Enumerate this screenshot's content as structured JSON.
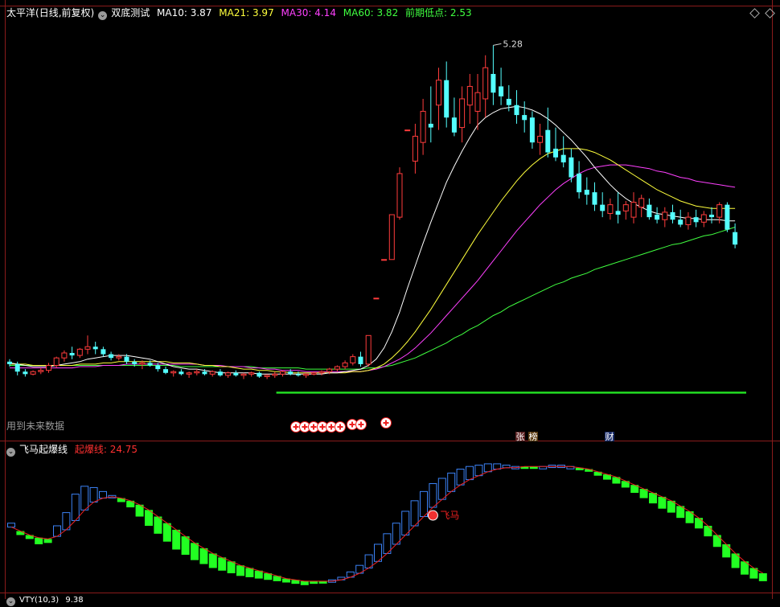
{
  "header_main": {
    "stock": "太平洋",
    "period": "(日线,前复权)",
    "indicator": "双底测试",
    "ma10": "MA10: 3.87",
    "ma21": "MA21: 3.97",
    "ma30": "MA30: 4.14",
    "ma60": "MA60: 3.82",
    "prev_low": "前期低点: 2.53"
  },
  "header_sub": {
    "indicator": "飞马起爆线",
    "line": "起爆线: 24.75"
  },
  "footer_sub": {
    "indicator": "VTY(10,3)",
    "value": "9.38"
  },
  "labels": {
    "future_data": "用到未来数据",
    "tag_zhang": "张",
    "tag_bang": "榜",
    "tag_cai": "财",
    "feima": "飞马",
    "high_price": "5.28"
  },
  "colors": {
    "up": "#ff3c3c",
    "down": "#54ffff",
    "ma10": "#ffffff",
    "ma21": "#ffff3c",
    "ma30": "#ff40ff",
    "ma60": "#40ff40",
    "prev_low": "#22dd22",
    "kline_rise": "#3b82f6",
    "kline_fall": "#22ff22",
    "signal": "#ee2020"
  },
  "chart_data": [
    {
      "type": "candlestick",
      "title": "太平洋 (日线,前复权)",
      "ylim": [
        2.3,
        5.45
      ],
      "high_mark": 5.28,
      "prev_low": 2.53,
      "series_names": [
        "MA10",
        "MA21",
        "MA30",
        "MA60"
      ],
      "candles": [
        [
          2.74,
          2.76,
          2.7,
          2.72
        ],
        [
          2.72,
          2.74,
          2.63,
          2.66
        ],
        [
          2.66,
          2.68,
          2.62,
          2.64
        ],
        [
          2.64,
          2.67,
          2.63,
          2.66
        ],
        [
          2.66,
          2.69,
          2.64,
          2.67
        ],
        [
          2.67,
          2.73,
          2.65,
          2.71
        ],
        [
          2.71,
          2.78,
          2.69,
          2.77
        ],
        [
          2.77,
          2.83,
          2.74,
          2.81
        ],
        [
          2.81,
          2.86,
          2.76,
          2.79
        ],
        [
          2.79,
          2.85,
          2.77,
          2.84
        ],
        [
          2.84,
          2.95,
          2.8,
          2.86
        ],
        [
          2.86,
          2.9,
          2.8,
          2.84
        ],
        [
          2.84,
          2.86,
          2.78,
          2.8
        ],
        [
          2.8,
          2.82,
          2.75,
          2.77
        ],
        [
          2.77,
          2.8,
          2.75,
          2.78
        ],
        [
          2.78,
          2.8,
          2.72,
          2.74
        ],
        [
          2.74,
          2.76,
          2.7,
          2.72
        ],
        [
          2.72,
          2.75,
          2.68,
          2.73
        ],
        [
          2.73,
          2.75,
          2.7,
          2.71
        ],
        [
          2.71,
          2.73,
          2.66,
          2.68
        ],
        [
          2.68,
          2.7,
          2.64,
          2.65
        ],
        [
          2.65,
          2.67,
          2.62,
          2.66
        ],
        [
          2.66,
          2.68,
          2.63,
          2.64
        ],
        [
          2.64,
          2.66,
          2.61,
          2.65
        ],
        [
          2.65,
          2.68,
          2.63,
          2.66
        ],
        [
          2.66,
          2.68,
          2.63,
          2.64
        ],
        [
          2.64,
          2.67,
          2.62,
          2.66
        ],
        [
          2.66,
          2.68,
          2.62,
          2.63
        ],
        [
          2.63,
          2.66,
          2.61,
          2.65
        ],
        [
          2.65,
          2.67,
          2.62,
          2.63
        ],
        [
          2.63,
          2.65,
          2.6,
          2.64
        ],
        [
          2.64,
          2.66,
          2.62,
          2.65
        ],
        [
          2.65,
          2.66,
          2.61,
          2.62
        ],
        [
          2.62,
          2.64,
          2.6,
          2.63
        ],
        [
          2.63,
          2.66,
          2.61,
          2.64
        ],
        [
          2.64,
          2.67,
          2.62,
          2.66
        ],
        [
          2.66,
          2.68,
          2.63,
          2.64
        ],
        [
          2.64,
          2.66,
          2.62,
          2.63
        ],
        [
          2.63,
          2.65,
          2.61,
          2.64
        ],
        [
          2.64,
          2.66,
          2.63,
          2.65
        ],
        [
          2.65,
          2.67,
          2.63,
          2.66
        ],
        [
          2.66,
          2.69,
          2.64,
          2.68
        ],
        [
          2.68,
          2.71,
          2.66,
          2.7
        ],
        [
          2.7,
          2.75,
          2.68,
          2.73
        ],
        [
          2.73,
          2.8,
          2.71,
          2.78
        ],
        [
          2.78,
          2.82,
          2.7,
          2.72
        ],
        [
          2.72,
          2.95,
          2.7,
          2.95
        ],
        [
          3.25,
          3.25,
          3.25,
          3.25
        ],
        [
          3.56,
          3.56,
          3.56,
          3.56
        ],
        [
          3.56,
          3.92,
          3.56,
          3.92
        ],
        [
          3.9,
          4.3,
          3.88,
          4.25
        ],
        [
          4.6,
          4.6,
          4.6,
          4.6
        ],
        [
          4.35,
          4.65,
          4.25,
          4.55
        ],
        [
          4.5,
          4.85,
          4.4,
          4.75
        ],
        [
          4.65,
          4.95,
          4.5,
          4.62
        ],
        [
          4.8,
          5.1,
          4.6,
          5.0
        ],
        [
          5.0,
          5.15,
          4.62,
          4.7
        ],
        [
          4.7,
          4.86,
          4.55,
          4.58
        ],
        [
          4.62,
          4.95,
          4.5,
          4.85
        ],
        [
          4.8,
          5.05,
          4.65,
          4.95
        ],
        [
          4.75,
          5.05,
          4.6,
          4.9
        ],
        [
          4.85,
          5.2,
          4.7,
          5.1
        ],
        [
          5.05,
          5.28,
          4.8,
          4.9
        ],
        [
          4.95,
          5.1,
          4.8,
          4.87
        ],
        [
          4.85,
          4.96,
          4.75,
          4.8
        ],
        [
          4.8,
          4.92,
          4.65,
          4.72
        ],
        [
          4.72,
          4.83,
          4.58,
          4.68
        ],
        [
          4.7,
          4.75,
          4.45,
          4.5
        ],
        [
          4.5,
          4.65,
          4.4,
          4.55
        ],
        [
          4.6,
          4.78,
          4.38,
          4.42
        ],
        [
          4.45,
          4.62,
          4.35,
          4.38
        ],
        [
          4.4,
          4.55,
          4.3,
          4.34
        ],
        [
          4.38,
          4.45,
          4.18,
          4.22
        ],
        [
          4.25,
          4.35,
          4.05,
          4.1
        ],
        [
          4.12,
          4.22,
          4.0,
          4.08
        ],
        [
          4.1,
          4.18,
          3.95,
          4.0
        ],
        [
          4.0,
          4.1,
          3.9,
          3.95
        ],
        [
          3.93,
          4.05,
          3.88,
          4.0
        ],
        [
          3.95,
          4.1,
          3.85,
          3.92
        ],
        [
          3.95,
          4.03,
          3.88,
          4.0
        ],
        [
          3.9,
          4.1,
          3.85,
          4.02
        ],
        [
          3.98,
          4.08,
          3.9,
          4.05
        ],
        [
          4.0,
          4.05,
          3.88,
          3.9
        ],
        [
          3.92,
          3.98,
          3.85,
          3.88
        ],
        [
          3.88,
          3.98,
          3.82,
          3.94
        ],
        [
          3.94,
          4.0,
          3.85,
          3.88
        ],
        [
          3.88,
          3.96,
          3.82,
          3.84
        ],
        [
          3.84,
          3.94,
          3.8,
          3.9
        ],
        [
          3.9,
          3.96,
          3.82,
          3.86
        ],
        [
          3.86,
          3.95,
          3.82,
          3.92
        ],
        [
          3.92,
          3.98,
          3.85,
          3.9
        ],
        [
          3.9,
          4.02,
          3.85,
          4.0
        ],
        [
          4.0,
          4.02,
          3.78,
          3.8
        ],
        [
          3.78,
          3.85,
          3.65,
          3.68
        ]
      ],
      "ma10": [
        2.73,
        2.72,
        2.71,
        2.7,
        2.7,
        2.7,
        2.71,
        2.72,
        2.73,
        2.74,
        2.76,
        2.77,
        2.78,
        2.79,
        2.79,
        2.79,
        2.78,
        2.77,
        2.76,
        2.74,
        2.72,
        2.7,
        2.69,
        2.68,
        2.68,
        2.67,
        2.66,
        2.65,
        2.65,
        2.65,
        2.65,
        2.65,
        2.64,
        2.64,
        2.64,
        2.64,
        2.64,
        2.64,
        2.64,
        2.64,
        2.64,
        2.65,
        2.65,
        2.66,
        2.67,
        2.68,
        2.71,
        2.76,
        2.85,
        2.98,
        3.14,
        3.33,
        3.51,
        3.69,
        3.86,
        4.02,
        4.18,
        4.31,
        4.43,
        4.54,
        4.64,
        4.7,
        4.74,
        4.77,
        4.78,
        4.79,
        4.78,
        4.76,
        4.73,
        4.69,
        4.64,
        4.58,
        4.52,
        4.45,
        4.38,
        4.3,
        4.23,
        4.16,
        4.1,
        4.05,
        4.01,
        3.98,
        3.95,
        3.93,
        3.92,
        3.91,
        3.9,
        3.89,
        3.89,
        3.88,
        3.88,
        3.88,
        3.87,
        3.87
      ],
      "ma21": [
        2.72,
        2.72,
        2.72,
        2.71,
        2.71,
        2.71,
        2.71,
        2.71,
        2.71,
        2.72,
        2.72,
        2.72,
        2.73,
        2.73,
        2.74,
        2.74,
        2.74,
        2.74,
        2.74,
        2.74,
        2.74,
        2.73,
        2.73,
        2.73,
        2.72,
        2.71,
        2.71,
        2.7,
        2.7,
        2.69,
        2.68,
        2.68,
        2.67,
        2.67,
        2.66,
        2.66,
        2.65,
        2.65,
        2.65,
        2.65,
        2.65,
        2.65,
        2.65,
        2.65,
        2.66,
        2.66,
        2.67,
        2.69,
        2.72,
        2.77,
        2.83,
        2.9,
        2.98,
        3.07,
        3.16,
        3.26,
        3.36,
        3.46,
        3.56,
        3.66,
        3.76,
        3.85,
        3.94,
        4.03,
        4.11,
        4.19,
        4.26,
        4.32,
        4.37,
        4.41,
        4.43,
        4.45,
        4.45,
        4.45,
        4.44,
        4.42,
        4.39,
        4.36,
        4.32,
        4.28,
        4.24,
        4.2,
        4.16,
        4.12,
        4.09,
        4.06,
        4.03,
        4.01,
        3.99,
        3.98,
        3.97,
        3.97,
        3.97,
        3.97
      ],
      "ma30": [
        2.69,
        2.69,
        2.69,
        2.69,
        2.69,
        2.69,
        2.69,
        2.69,
        2.69,
        2.7,
        2.7,
        2.7,
        2.71,
        2.71,
        2.71,
        2.72,
        2.72,
        2.72,
        2.72,
        2.72,
        2.72,
        2.72,
        2.72,
        2.72,
        2.72,
        2.71,
        2.71,
        2.71,
        2.7,
        2.7,
        2.7,
        2.69,
        2.69,
        2.68,
        2.68,
        2.67,
        2.67,
        2.67,
        2.66,
        2.66,
        2.66,
        2.66,
        2.66,
        2.66,
        2.66,
        2.66,
        2.67,
        2.68,
        2.7,
        2.73,
        2.76,
        2.8,
        2.85,
        2.91,
        2.97,
        3.04,
        3.11,
        3.18,
        3.25,
        3.32,
        3.39,
        3.47,
        3.55,
        3.63,
        3.71,
        3.79,
        3.86,
        3.93,
        4.0,
        4.06,
        4.12,
        4.17,
        4.21,
        4.25,
        4.28,
        4.3,
        4.31,
        4.32,
        4.32,
        4.32,
        4.31,
        4.3,
        4.29,
        4.27,
        4.26,
        4.24,
        4.22,
        4.21,
        4.19,
        4.18,
        4.17,
        4.16,
        4.15,
        4.14
      ],
      "ma60": [
        2.71,
        2.71,
        2.71,
        2.71,
        2.71,
        2.71,
        2.71,
        2.71,
        2.71,
        2.71,
        2.71,
        2.71,
        2.71,
        2.71,
        2.71,
        2.71,
        2.71,
        2.71,
        2.71,
        2.71,
        2.71,
        2.71,
        2.7,
        2.7,
        2.7,
        2.7,
        2.7,
        2.7,
        2.7,
        2.7,
        2.7,
        2.7,
        2.69,
        2.69,
        2.69,
        2.69,
        2.69,
        2.69,
        2.68,
        2.68,
        2.68,
        2.68,
        2.68,
        2.68,
        2.68,
        2.68,
        2.69,
        2.69,
        2.7,
        2.71,
        2.73,
        2.75,
        2.77,
        2.8,
        2.83,
        2.86,
        2.89,
        2.93,
        2.96,
        3.0,
        3.03,
        3.07,
        3.11,
        3.14,
        3.18,
        3.21,
        3.24,
        3.27,
        3.3,
        3.33,
        3.36,
        3.38,
        3.41,
        3.43,
        3.45,
        3.48,
        3.5,
        3.52,
        3.54,
        3.56,
        3.58,
        3.6,
        3.62,
        3.64,
        3.66,
        3.68,
        3.69,
        3.71,
        3.73,
        3.75,
        3.76,
        3.78,
        3.8,
        3.82
      ],
      "buy_markers_index": [
        28,
        29,
        30,
        31,
        33,
        34,
        35,
        36,
        38
      ]
    },
    {
      "type": "line",
      "title": "飞马起爆线",
      "ylim": [
        0,
        100
      ],
      "series_names": [
        "起爆线"
      ],
      "k": [
        52,
        43,
        40,
        36,
        37,
        50,
        60,
        74,
        80,
        79,
        76,
        73,
        68,
        64,
        57,
        50,
        44,
        38,
        32,
        28,
        24,
        21,
        18,
        16,
        14,
        12,
        11,
        10,
        9,
        8,
        7,
        6,
        5,
        6,
        7,
        9,
        11,
        15,
        20,
        28,
        36,
        44,
        52,
        61,
        69,
        76,
        82,
        86,
        90,
        93,
        95,
        96,
        97,
        97,
        96,
        95,
        94,
        94,
        95,
        96,
        96,
        95,
        93,
        91,
        88,
        85,
        82,
        79,
        75,
        71,
        67,
        63,
        60,
        56,
        52,
        48,
        42,
        34,
        26,
        18,
        13,
        10,
        8
      ],
      "d": [
        49,
        46,
        43,
        41,
        40,
        42,
        47,
        54,
        62,
        68,
        71,
        72,
        71,
        69,
        66,
        62,
        57,
        52,
        47,
        42,
        37,
        33,
        29,
        26,
        23,
        20,
        18,
        16,
        14,
        12,
        10,
        9,
        8,
        8,
        8,
        8,
        9,
        11,
        14,
        18,
        23,
        29,
        36,
        43,
        50,
        57,
        64,
        70,
        76,
        81,
        85,
        88,
        91,
        93,
        94,
        94,
        95,
        95,
        95,
        95,
        95,
        95,
        94,
        93,
        91,
        89,
        87,
        84,
        81,
        78,
        75,
        72,
        69,
        65,
        61,
        56,
        50,
        43,
        36,
        29,
        23,
        18,
        14
      ],
      "signal_index": 46,
      "current": 24.75
    }
  ]
}
